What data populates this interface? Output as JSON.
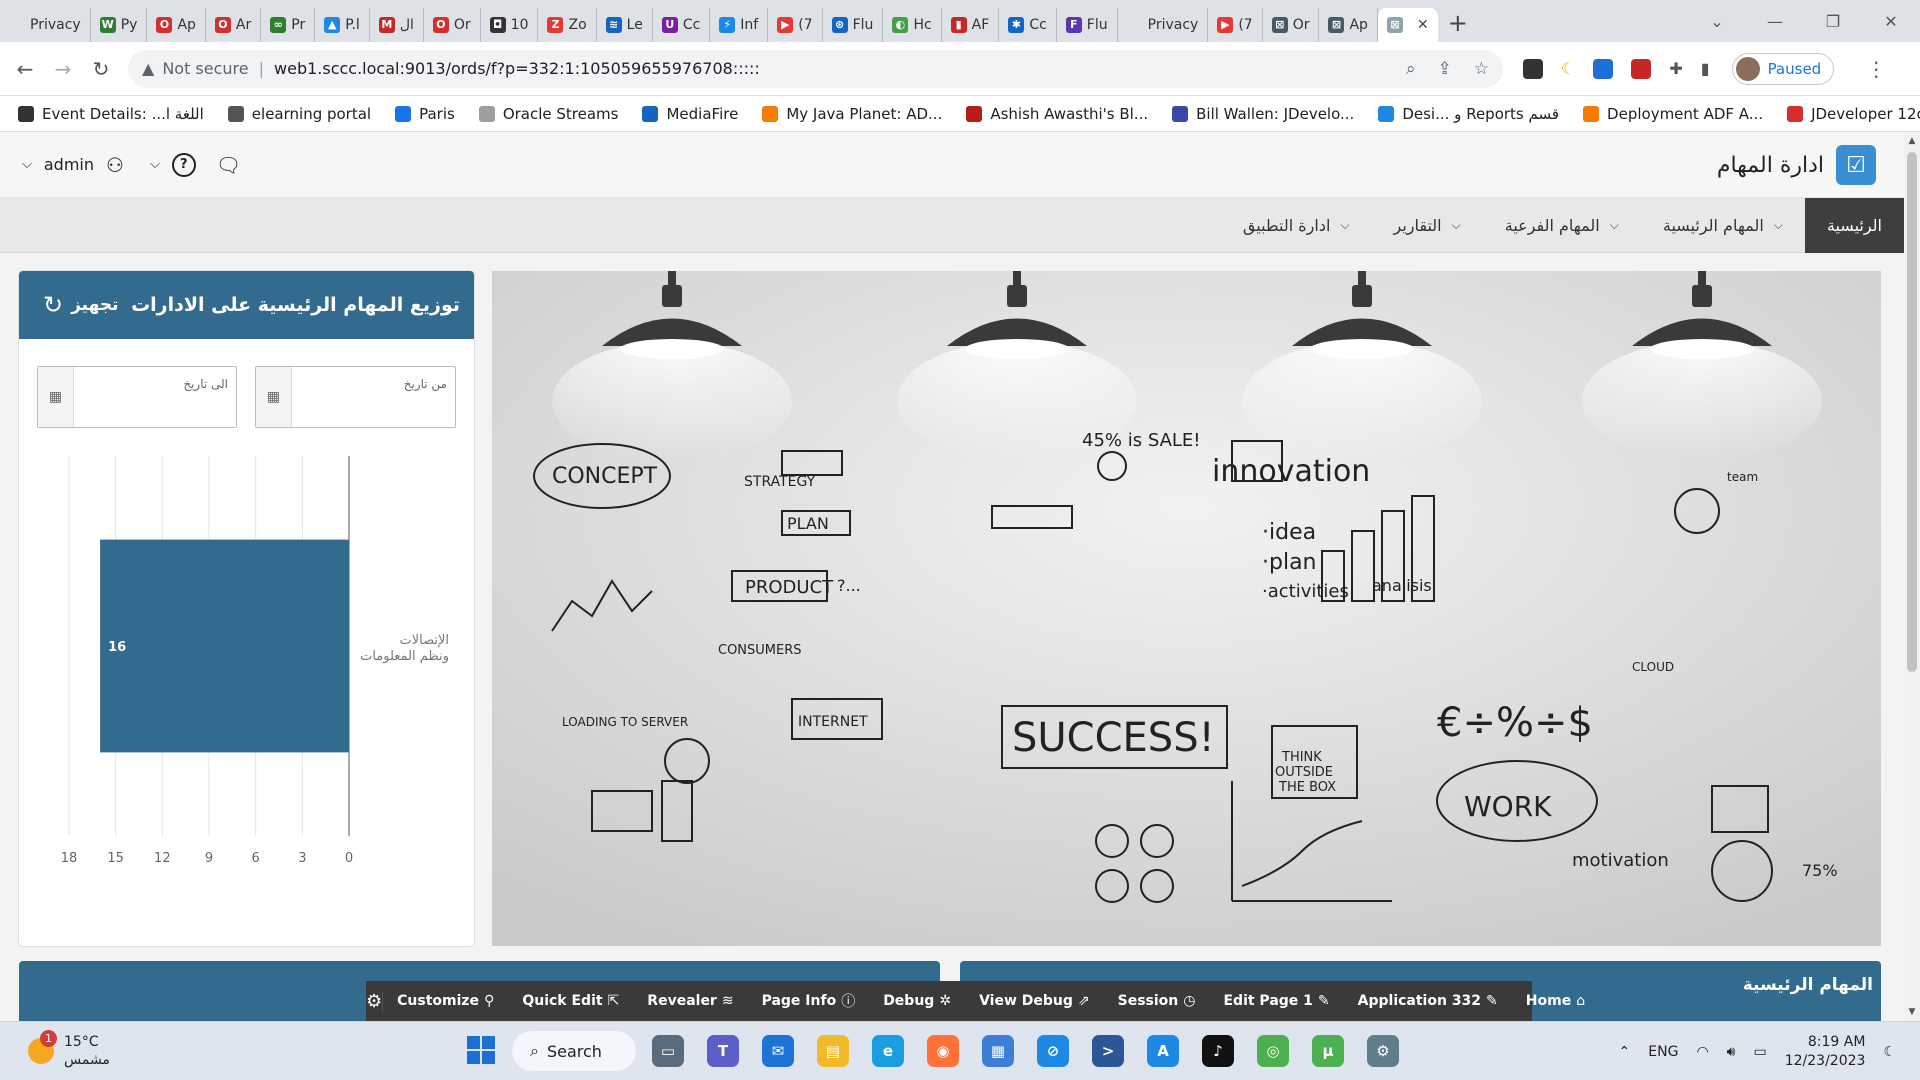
{
  "browser": {
    "tabs": [
      {
        "label": "Privacy",
        "color": "#dee1e6",
        "glyph": ""
      },
      {
        "label": "Py",
        "color": "#2e7d32",
        "glyph": "W"
      },
      {
        "label": "Ap",
        "color": "#d32f2f",
        "glyph": "O"
      },
      {
        "label": "Ar",
        "color": "#d32f2f",
        "glyph": "O"
      },
      {
        "label": "Pr",
        "color": "#2e7d32",
        "glyph": "∞"
      },
      {
        "label": "P.l",
        "color": "#1e88e5",
        "glyph": "▲"
      },
      {
        "label": "ال",
        "color": "#c62828",
        "glyph": "M"
      },
      {
        "label": "Or",
        "color": "#d32f2f",
        "glyph": "O"
      },
      {
        "label": "10",
        "color": "#333333",
        "glyph": "◘"
      },
      {
        "label": "Zo",
        "color": "#e53935",
        "glyph": "Z"
      },
      {
        "label": "Le",
        "color": "#1565c0",
        "glyph": "≋"
      },
      {
        "label": "Cc",
        "color": "#7b1fa2",
        "glyph": "U"
      },
      {
        "label": "Inf",
        "color": "#1e88e5",
        "glyph": "⚡"
      },
      {
        "label": "(7",
        "color": "#e53935",
        "glyph": "▶"
      },
      {
        "label": "Flu",
        "color": "#1565c0",
        "glyph": "⊛"
      },
      {
        "label": "Hc",
        "color": "#43a047",
        "glyph": "◐"
      },
      {
        "label": "AF",
        "color": "#c62828",
        "glyph": "▮"
      },
      {
        "label": "Cc",
        "color": "#1565c0",
        "glyph": "✱"
      },
      {
        "label": "Flu",
        "color": "#5e35b1",
        "glyph": "F"
      },
      {
        "label": "Privacy",
        "color": "#dee1e6",
        "glyph": ""
      },
      {
        "label": "(7",
        "color": "#e53935",
        "glyph": "▶"
      },
      {
        "label": "Or",
        "color": "#455a64",
        "glyph": "⊠"
      },
      {
        "label": "Ap",
        "color": "#455a64",
        "glyph": "⊠"
      }
    ],
    "active_tab": {
      "label": "",
      "glyph": "⊠"
    },
    "address": {
      "security": "Not secure",
      "url": "web1.sccc.local:9013/ords/f?p=332:1:105059655976708:::::"
    },
    "profile_status": "Paused",
    "bookmarks": [
      {
        "label": "Event Details: ...اللغة ا",
        "color": "#333333"
      },
      {
        "label": "elearning portal",
        "color": "#555555"
      },
      {
        "label": "Paris",
        "color": "#1a73e8"
      },
      {
        "label": "Oracle Streams",
        "color": "#9e9e9e"
      },
      {
        "label": "MediaFire",
        "color": "#1565c0"
      },
      {
        "label": "My Java Planet: AD...",
        "color": "#f57c00"
      },
      {
        "label": "Ashish Awasthi's Bl...",
        "color": "#b71c1c"
      },
      {
        "label": "Bill Wallen: JDevelo...",
        "color": "#3949ab"
      },
      {
        "label": "Desi... و Reports قسم",
        "color": "#1e88e5"
      },
      {
        "label": "Deployment ADF A...",
        "color": "#f57c00"
      },
      {
        "label": "JDeveloper 12c – O...",
        "color": "#d32f2f"
      }
    ],
    "bookmarks_more": "»"
  },
  "app": {
    "user": "admin",
    "title": "ادارة المهام",
    "menu": [
      {
        "label": "الرئيسية",
        "active": true,
        "has_sub": false
      },
      {
        "label": "المهام الرئيسية",
        "active": false,
        "has_sub": true
      },
      {
        "label": "المهام الفرعية",
        "active": false,
        "has_sub": true
      },
      {
        "label": "التقارير",
        "active": false,
        "has_sub": true
      },
      {
        "label": "ادارة التطبيق",
        "active": false,
        "has_sub": true
      }
    ]
  },
  "chart_region": {
    "title": "توزيع المهام الرئيسية على الادارات",
    "button": "تجهيز",
    "from_date_label": "من تاريخ",
    "to_date_label": "الى تاريخ"
  },
  "chart_data": {
    "type": "bar",
    "orientation": "horizontal",
    "categories": [
      "الإتصالات ونظم المعلومات"
    ],
    "values": [
      16
    ],
    "value_axis_ticks": [
      0,
      3,
      6,
      9,
      12,
      15,
      18
    ],
    "xlim": [
      0,
      18
    ],
    "axis_direction": "reversed",
    "bar_color": "#336b8e",
    "grid": true
  },
  "image_region": {
    "bg": "#d9dadc"
  },
  "bottom_regions": [
    {
      "title": "المهام الرئيسية"
    }
  ],
  "dev_toolbar": [
    {
      "label": "Customize",
      "icon": "⚲"
    },
    {
      "label": "Quick Edit",
      "icon": "⇱"
    },
    {
      "label": "Revealer",
      "icon": "≋"
    },
    {
      "label": "Page Info",
      "icon": "ⓘ"
    },
    {
      "label": "Debug",
      "icon": "✲"
    },
    {
      "label": "View Debug",
      "icon": "⇗"
    },
    {
      "label": "Session",
      "icon": "◷"
    },
    {
      "label": "Edit Page 1",
      "icon": "✎"
    },
    {
      "label": "Application 332",
      "icon": "✎"
    },
    {
      "label": "Home",
      "icon": "⌂"
    }
  ],
  "taskbar": {
    "weather_temp": "15°C",
    "weather_desc": "مشمس",
    "weather_badge": "1",
    "search": "Search",
    "lang": "ENG",
    "time": "8:19 AM",
    "date": "12/23/2023",
    "apps": [
      {
        "name": "task-view",
        "color": "#5a6b7d",
        "glyph": "▭"
      },
      {
        "name": "teams",
        "color": "#5b5fc7",
        "glyph": "T"
      },
      {
        "name": "mail",
        "color": "#1e73d6",
        "glyph": "✉"
      },
      {
        "name": "file-explorer",
        "color": "#f2b928",
        "glyph": "▤"
      },
      {
        "name": "edge",
        "color": "#1b9de2",
        "glyph": "e"
      },
      {
        "name": "firefox",
        "color": "#ff7139",
        "glyph": "◉"
      },
      {
        "name": "store",
        "color": "#3c7fd6",
        "glyph": "▦"
      },
      {
        "name": "safari",
        "color": "#1e88e5",
        "glyph": "⊘"
      },
      {
        "name": "powershell",
        "color": "#2b5797",
        "glyph": ">"
      },
      {
        "name": "app-store",
        "color": "#1e88e5",
        "glyph": "A"
      },
      {
        "name": "tiktok",
        "color": "#111111",
        "glyph": "♪"
      },
      {
        "name": "chrome",
        "color": "#4caf50",
        "glyph": "◎"
      },
      {
        "name": "utorrent",
        "color": "#4caf50",
        "glyph": "µ"
      },
      {
        "name": "settings",
        "color": "#607d8b",
        "glyph": "⚙"
      }
    ]
  }
}
